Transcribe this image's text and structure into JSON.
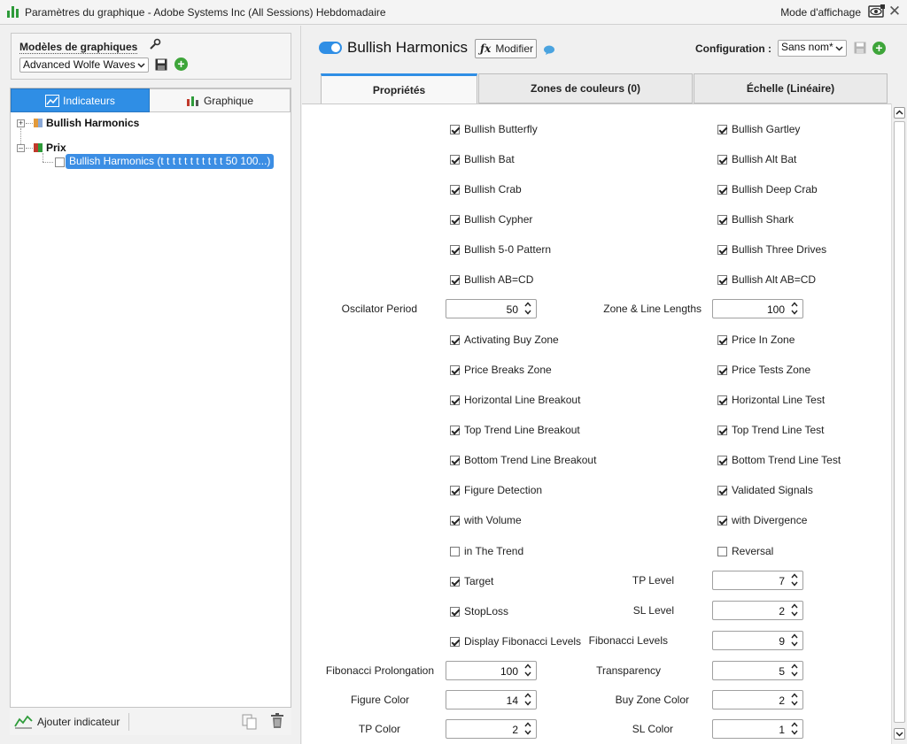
{
  "window": {
    "title": "Paramètres du graphique - Adobe Systems Inc (All Sessions) Hebdomadaire",
    "view_mode": "Mode d'affichage"
  },
  "left": {
    "templates_label": "Modèles de graphiques",
    "template_value": "Advanced Wolfe Waves",
    "tab_indicators": "Indicateurs",
    "tab_chart": "Graphique",
    "tree": {
      "item1": "Bullish Harmonics",
      "item2": "Prix",
      "child": "Bullish Harmonics (t t t t t t t t t t t 50 100...)"
    },
    "add_indicator": "Ajouter indicateur"
  },
  "header": {
    "indicator_name": "Bullish Harmonics",
    "modify": "Modifier",
    "config_label": "Configuration :",
    "config_value": "Sans nom*"
  },
  "tabs": {
    "properties": "Propriétés",
    "color_zones": "Zones de couleurs (0)",
    "scale": "Échelle (Linéaire)"
  },
  "props": {
    "cb_butterfly": "Bullish Butterfly",
    "cb_gartley": "Bullish Gartley",
    "cb_bat": "Bullish Bat",
    "cb_altbat": "Bullish Alt Bat",
    "cb_crab": "Bullish Crab",
    "cb_deepcrab": "Bullish Deep Crab",
    "cb_cypher": "Bullish Cypher",
    "cb_shark": "Bullish Shark",
    "cb_50": "Bullish 5-0 Pattern",
    "cb_threedrives": "Bullish Three Drives",
    "cb_abcd": "Bullish AB=CD",
    "cb_altabcd": "Bullish Alt AB=CD",
    "osc_label": "Oscilator Period",
    "osc_value": "50",
    "zone_label": "Zone & Line Lengths",
    "zone_value": "100",
    "cb_actbuy": "Activating Buy Zone",
    "cb_priceinzone": "Price In Zone",
    "cb_pricebreaks": "Price Breaks Zone",
    "cb_pricetests": "Price Tests Zone",
    "cb_hlinebreak": "Horizontal Line Breakout",
    "cb_hlinetest": "Horizontal Line Test",
    "cb_toptrendbreak": "Top Trend Line Breakout",
    "cb_toptrendtest": "Top Trend Line Test",
    "cb_bottrendbreak": "Bottom Trend Line Breakout",
    "cb_bottrendtest": "Bottom Trend Line Test",
    "cb_figdet": "Figure Detection",
    "cb_validated": "Validated Signals",
    "cb_volume": "with Volume",
    "cb_divergence": "with Divergence",
    "cb_intrend": "in The Trend",
    "cb_reversal": "Reversal",
    "cb_target": "Target",
    "tp_level_label": "TP Level",
    "tp_level_value": "7",
    "cb_stoploss": "StopLoss",
    "sl_level_label": "SL Level",
    "sl_level_value": "2",
    "cb_fibo": "Display Fibonacci Levels",
    "fibo_levels_label": "Fibonacci Levels",
    "fibo_levels_value": "9",
    "fibo_prol_label": "Fibonacci Prolongation",
    "fibo_prol_value": "100",
    "transparency_label": "Transparency",
    "transparency_value": "5",
    "figure_color_label": "Figure Color",
    "figure_color_value": "14",
    "buyzone_color_label": "Buy Zone Color",
    "buyzone_color_value": "2",
    "tp_color_label": "TP Color",
    "tp_color_value": "2",
    "sl_color_label": "SL Color",
    "sl_color_value": "1"
  },
  "checked": {
    "cb_butterfly": true,
    "cb_gartley": true,
    "cb_bat": true,
    "cb_altbat": true,
    "cb_crab": true,
    "cb_deepcrab": true,
    "cb_cypher": true,
    "cb_shark": true,
    "cb_50": true,
    "cb_threedrives": true,
    "cb_abcd": true,
    "cb_altabcd": true,
    "cb_actbuy": true,
    "cb_priceinzone": true,
    "cb_pricebreaks": true,
    "cb_pricetests": true,
    "cb_hlinebreak": true,
    "cb_hlinetest": true,
    "cb_toptrendbreak": true,
    "cb_toptrendtest": true,
    "cb_bottrendbreak": true,
    "cb_bottrendtest": true,
    "cb_figdet": true,
    "cb_validated": true,
    "cb_volume": true,
    "cb_divergence": true,
    "cb_intrend": false,
    "cb_reversal": false,
    "cb_target": true,
    "cb_stoploss": true,
    "cb_fibo": true
  },
  "colors": {
    "accent": "#2f8ee5",
    "add_green": "#3ea53a"
  }
}
